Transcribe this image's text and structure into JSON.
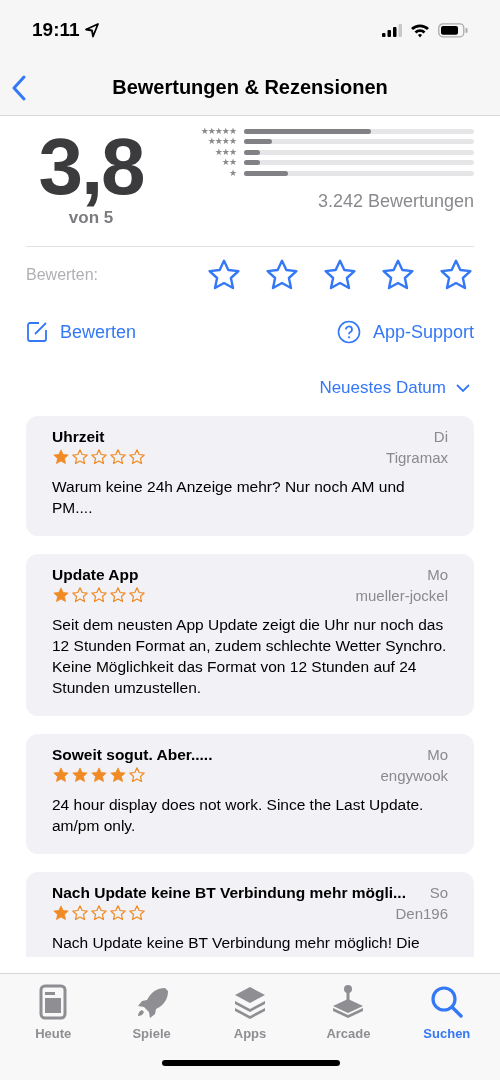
{
  "status_bar": {
    "time": "19:11"
  },
  "nav": {
    "title": "Bewertungen & Rezensionen"
  },
  "summary": {
    "score": "3,8",
    "out_of": "von 5",
    "count": "3.242 Bewertungen",
    "histogram": [
      {
        "label": "★★★★★",
        "level": 0.55
      },
      {
        "label": "★★★★",
        "level": 0.12
      },
      {
        "label": "★★★",
        "level": 0.07
      },
      {
        "label": "★★",
        "level": 0.07
      },
      {
        "label": "★",
        "level": 0.19
      }
    ]
  },
  "rate": {
    "label": "Bewerten:",
    "stars": 0
  },
  "actions": [
    {
      "kind": "write",
      "label": "Bewerten"
    },
    {
      "kind": "support",
      "label": "App-Support"
    }
  ],
  "sort": {
    "label": "Neuestes Datum"
  },
  "reviews": [
    {
      "title": "Uhrzeit",
      "day": "Di",
      "stars": 1,
      "author": "Tigramax",
      "body": "Warum keine 24h Anzeige mehr? Nur noch AM und PM...."
    },
    {
      "title": "Update App",
      "day": "Mo",
      "stars": 1,
      "author": "mueller-jockel",
      "body": "Seit dem neusten App Update zeigt die Uhr nur noch das 12 Stunden Format an, zudem schlechte Wetter Synchro. Keine Möglichkeit das Format von 12 Stunden auf 24 Stunden umzustellen."
    },
    {
      "title": "Soweit sogut. Aber.....",
      "day": "Mo",
      "stars": 4,
      "author": "engywook",
      "body": "24 hour display does not work.  Since the Last Update. am/pm only."
    },
    {
      "title": "Nach Update keine BT Verbindung mehr mögli...",
      "day": "So",
      "stars": 1,
      "author": "Den196",
      "body": "Nach Update keine BT Verbindung mehr möglich! Die"
    }
  ],
  "tab_bar": [
    {
      "kind": "today",
      "label": "Heute",
      "selected": false
    },
    {
      "kind": "games",
      "label": "Spiele",
      "selected": false
    },
    {
      "kind": "apps",
      "label": "Apps",
      "selected": false
    },
    {
      "kind": "arcade",
      "label": "Arcade",
      "selected": false
    },
    {
      "kind": "search",
      "label": "Suchen",
      "selected": true
    }
  ]
}
